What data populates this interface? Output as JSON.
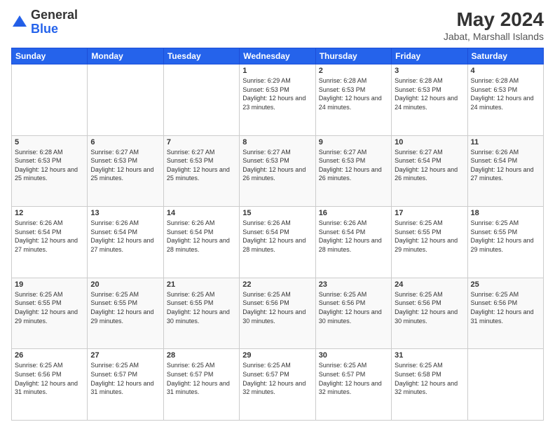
{
  "logo": {
    "general": "General",
    "blue": "Blue"
  },
  "title": {
    "month_year": "May 2024",
    "location": "Jabat, Marshall Islands"
  },
  "days_of_week": [
    "Sunday",
    "Monday",
    "Tuesday",
    "Wednesday",
    "Thursday",
    "Friday",
    "Saturday"
  ],
  "weeks": [
    [
      {
        "day": "",
        "sunrise": "",
        "sunset": "",
        "daylight": ""
      },
      {
        "day": "",
        "sunrise": "",
        "sunset": "",
        "daylight": ""
      },
      {
        "day": "",
        "sunrise": "",
        "sunset": "",
        "daylight": ""
      },
      {
        "day": "1",
        "sunrise": "Sunrise: 6:29 AM",
        "sunset": "Sunset: 6:53 PM",
        "daylight": "Daylight: 12 hours and 23 minutes."
      },
      {
        "day": "2",
        "sunrise": "Sunrise: 6:28 AM",
        "sunset": "Sunset: 6:53 PM",
        "daylight": "Daylight: 12 hours and 24 minutes."
      },
      {
        "day": "3",
        "sunrise": "Sunrise: 6:28 AM",
        "sunset": "Sunset: 6:53 PM",
        "daylight": "Daylight: 12 hours and 24 minutes."
      },
      {
        "day": "4",
        "sunrise": "Sunrise: 6:28 AM",
        "sunset": "Sunset: 6:53 PM",
        "daylight": "Daylight: 12 hours and 24 minutes."
      }
    ],
    [
      {
        "day": "5",
        "sunrise": "Sunrise: 6:28 AM",
        "sunset": "Sunset: 6:53 PM",
        "daylight": "Daylight: 12 hours and 25 minutes."
      },
      {
        "day": "6",
        "sunrise": "Sunrise: 6:27 AM",
        "sunset": "Sunset: 6:53 PM",
        "daylight": "Daylight: 12 hours and 25 minutes."
      },
      {
        "day": "7",
        "sunrise": "Sunrise: 6:27 AM",
        "sunset": "Sunset: 6:53 PM",
        "daylight": "Daylight: 12 hours and 25 minutes."
      },
      {
        "day": "8",
        "sunrise": "Sunrise: 6:27 AM",
        "sunset": "Sunset: 6:53 PM",
        "daylight": "Daylight: 12 hours and 26 minutes."
      },
      {
        "day": "9",
        "sunrise": "Sunrise: 6:27 AM",
        "sunset": "Sunset: 6:53 PM",
        "daylight": "Daylight: 12 hours and 26 minutes."
      },
      {
        "day": "10",
        "sunrise": "Sunrise: 6:27 AM",
        "sunset": "Sunset: 6:54 PM",
        "daylight": "Daylight: 12 hours and 26 minutes."
      },
      {
        "day": "11",
        "sunrise": "Sunrise: 6:26 AM",
        "sunset": "Sunset: 6:54 PM",
        "daylight": "Daylight: 12 hours and 27 minutes."
      }
    ],
    [
      {
        "day": "12",
        "sunrise": "Sunrise: 6:26 AM",
        "sunset": "Sunset: 6:54 PM",
        "daylight": "Daylight: 12 hours and 27 minutes."
      },
      {
        "day": "13",
        "sunrise": "Sunrise: 6:26 AM",
        "sunset": "Sunset: 6:54 PM",
        "daylight": "Daylight: 12 hours and 27 minutes."
      },
      {
        "day": "14",
        "sunrise": "Sunrise: 6:26 AM",
        "sunset": "Sunset: 6:54 PM",
        "daylight": "Daylight: 12 hours and 28 minutes."
      },
      {
        "day": "15",
        "sunrise": "Sunrise: 6:26 AM",
        "sunset": "Sunset: 6:54 PM",
        "daylight": "Daylight: 12 hours and 28 minutes."
      },
      {
        "day": "16",
        "sunrise": "Sunrise: 6:26 AM",
        "sunset": "Sunset: 6:54 PM",
        "daylight": "Daylight: 12 hours and 28 minutes."
      },
      {
        "day": "17",
        "sunrise": "Sunrise: 6:25 AM",
        "sunset": "Sunset: 6:55 PM",
        "daylight": "Daylight: 12 hours and 29 minutes."
      },
      {
        "day": "18",
        "sunrise": "Sunrise: 6:25 AM",
        "sunset": "Sunset: 6:55 PM",
        "daylight": "Daylight: 12 hours and 29 minutes."
      }
    ],
    [
      {
        "day": "19",
        "sunrise": "Sunrise: 6:25 AM",
        "sunset": "Sunset: 6:55 PM",
        "daylight": "Daylight: 12 hours and 29 minutes."
      },
      {
        "day": "20",
        "sunrise": "Sunrise: 6:25 AM",
        "sunset": "Sunset: 6:55 PM",
        "daylight": "Daylight: 12 hours and 29 minutes."
      },
      {
        "day": "21",
        "sunrise": "Sunrise: 6:25 AM",
        "sunset": "Sunset: 6:55 PM",
        "daylight": "Daylight: 12 hours and 30 minutes."
      },
      {
        "day": "22",
        "sunrise": "Sunrise: 6:25 AM",
        "sunset": "Sunset: 6:56 PM",
        "daylight": "Daylight: 12 hours and 30 minutes."
      },
      {
        "day": "23",
        "sunrise": "Sunrise: 6:25 AM",
        "sunset": "Sunset: 6:56 PM",
        "daylight": "Daylight: 12 hours and 30 minutes."
      },
      {
        "day": "24",
        "sunrise": "Sunrise: 6:25 AM",
        "sunset": "Sunset: 6:56 PM",
        "daylight": "Daylight: 12 hours and 30 minutes."
      },
      {
        "day": "25",
        "sunrise": "Sunrise: 6:25 AM",
        "sunset": "Sunset: 6:56 PM",
        "daylight": "Daylight: 12 hours and 31 minutes."
      }
    ],
    [
      {
        "day": "26",
        "sunrise": "Sunrise: 6:25 AM",
        "sunset": "Sunset: 6:56 PM",
        "daylight": "Daylight: 12 hours and 31 minutes."
      },
      {
        "day": "27",
        "sunrise": "Sunrise: 6:25 AM",
        "sunset": "Sunset: 6:57 PM",
        "daylight": "Daylight: 12 hours and 31 minutes."
      },
      {
        "day": "28",
        "sunrise": "Sunrise: 6:25 AM",
        "sunset": "Sunset: 6:57 PM",
        "daylight": "Daylight: 12 hours and 31 minutes."
      },
      {
        "day": "29",
        "sunrise": "Sunrise: 6:25 AM",
        "sunset": "Sunset: 6:57 PM",
        "daylight": "Daylight: 12 hours and 32 minutes."
      },
      {
        "day": "30",
        "sunrise": "Sunrise: 6:25 AM",
        "sunset": "Sunset: 6:57 PM",
        "daylight": "Daylight: 12 hours and 32 minutes."
      },
      {
        "day": "31",
        "sunrise": "Sunrise: 6:25 AM",
        "sunset": "Sunset: 6:58 PM",
        "daylight": "Daylight: 12 hours and 32 minutes."
      },
      {
        "day": "",
        "sunrise": "",
        "sunset": "",
        "daylight": ""
      }
    ]
  ]
}
